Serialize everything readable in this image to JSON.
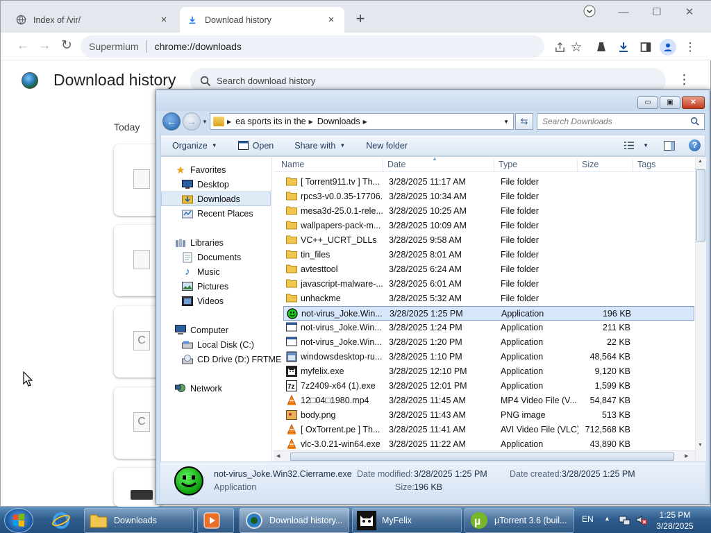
{
  "browser": {
    "tabs": [
      {
        "title": "Index of /vir/",
        "active": false
      },
      {
        "title": "Download history",
        "active": true
      }
    ],
    "new_tab": "+",
    "window_buttons": {
      "minimize": "—",
      "maximize": "☐",
      "close": "✕"
    },
    "omnibox": {
      "site": "Supermium",
      "url": "chrome://downloads"
    }
  },
  "downloads_page": {
    "title": "Download history",
    "search_placeholder": "Search download history",
    "section_date": "Today"
  },
  "explorer": {
    "breadcrumb": [
      "ea sports its in the",
      "Downloads"
    ],
    "search_placeholder": "Search Downloads",
    "commands": {
      "organize": "Organize",
      "open": "Open",
      "share_with": "Share with",
      "new_folder": "New folder"
    },
    "nav_pane": {
      "favorites_header": "Favorites",
      "favorites": [
        "Desktop",
        "Downloads",
        "Recent Places"
      ],
      "libraries_header": "Libraries",
      "libraries": [
        "Documents",
        "Music",
        "Pictures",
        "Videos"
      ],
      "computer_header": "Computer",
      "computer": [
        "Local Disk (C:)",
        "CD Drive (D:) FRTME"
      ],
      "network_header": "Network"
    },
    "columns": [
      "Name",
      "Date",
      "Type",
      "Size",
      "Tags"
    ],
    "files": [
      {
        "name": "[ Torrent911.tv ] Th...",
        "date": "3/28/2025 11:17 AM",
        "type": "File folder",
        "size": "",
        "icon": "folder-icon"
      },
      {
        "name": "rpcs3-v0.0.35-17706...",
        "date": "3/28/2025 10:34 AM",
        "type": "File folder",
        "size": "",
        "icon": "folder-icon"
      },
      {
        "name": "mesa3d-25.0.1-rele...",
        "date": "3/28/2025 10:25 AM",
        "type": "File folder",
        "size": "",
        "icon": "folder-icon"
      },
      {
        "name": "wallpapers-pack-m...",
        "date": "3/28/2025 10:09 AM",
        "type": "File folder",
        "size": "",
        "icon": "folder-icon"
      },
      {
        "name": "VC++_UCRT_DLLs",
        "date": "3/28/2025 9:58 AM",
        "type": "File folder",
        "size": "",
        "icon": "folder-icon"
      },
      {
        "name": "tin_files",
        "date": "3/28/2025 8:01 AM",
        "type": "File folder",
        "size": "",
        "icon": "folder-icon"
      },
      {
        "name": "avtesttool",
        "date": "3/28/2025 6:24 AM",
        "type": "File folder",
        "size": "",
        "icon": "folder-icon"
      },
      {
        "name": "javascript-malware-...",
        "date": "3/28/2025 6:01 AM",
        "type": "File folder",
        "size": "",
        "icon": "folder-icon"
      },
      {
        "name": "unhackme",
        "date": "3/28/2025 5:32 AM",
        "type": "File folder",
        "size": "",
        "icon": "folder-icon"
      },
      {
        "name": "not-virus_Joke.Win...",
        "date": "3/28/2025 1:25 PM",
        "type": "Application",
        "size": "196 KB",
        "icon": "smiley-app-icon",
        "selected": true
      },
      {
        "name": "not-virus_Joke.Win...",
        "date": "3/28/2025 1:24 PM",
        "type": "Application",
        "size": "211 KB",
        "icon": "app-window-icon"
      },
      {
        "name": "not-virus_Joke.Win...",
        "date": "3/28/2025 1:20 PM",
        "type": "Application",
        "size": "22 KB",
        "icon": "app-window-icon"
      },
      {
        "name": "windowsdesktop-ru...",
        "date": "3/28/2025 1:10 PM",
        "type": "Application",
        "size": "48,564 KB",
        "icon": "installer-icon"
      },
      {
        "name": "myfelix.exe",
        "date": "3/28/2025 12:10 PM",
        "type": "Application",
        "size": "9,120 KB",
        "icon": "cat-icon"
      },
      {
        "name": "7z2409-x64 (1).exe",
        "date": "3/28/2025 12:01 PM",
        "type": "Application",
        "size": "1,599 KB",
        "icon": "7zip-icon"
      },
      {
        "name": "12□04□1980.mp4",
        "date": "3/28/2025 11:45 AM",
        "type": "MP4 Video File (V...",
        "size": "54,847 KB",
        "icon": "vlc-icon"
      },
      {
        "name": "body.png",
        "date": "3/28/2025 11:43 AM",
        "type": "PNG image",
        "size": "513 KB",
        "icon": "image-icon"
      },
      {
        "name": "[ OxTorrent.pe ] Th...",
        "date": "3/28/2025 11:41 AM",
        "type": "AVI Video File (VLC)",
        "size": "712,568 KB",
        "icon": "vlc-icon"
      },
      {
        "name": "vlc-3.0.21-win64.exe",
        "date": "3/28/2025 11:22 AM",
        "type": "Application",
        "size": "43,890 KB",
        "icon": "vlc-icon"
      }
    ],
    "details": {
      "filename": "not-virus_Joke.Win32.Cierrame.exe",
      "type": "Application",
      "modified_label": "Date modified:",
      "modified_value": "3/28/2025 1:25 PM",
      "created_label": "Date created:",
      "created_value": "3/28/2025 1:25 PM",
      "size_label": "Size:",
      "size_value": "196 KB"
    }
  },
  "taskbar": {
    "buttons": [
      {
        "label": "Downloads",
        "icon": "folder-icon"
      },
      {
        "label": "",
        "icon": "media-player-icon"
      },
      {
        "label": "Download history...",
        "icon": "supermium-icon"
      },
      {
        "label": "MyFelix",
        "icon": "cat-icon"
      },
      {
        "label": "µTorrent 3.6 (buil...",
        "icon": "utorrent-icon"
      }
    ],
    "lang": "EN",
    "time": "1:25 PM",
    "date": "3/28/2025"
  }
}
